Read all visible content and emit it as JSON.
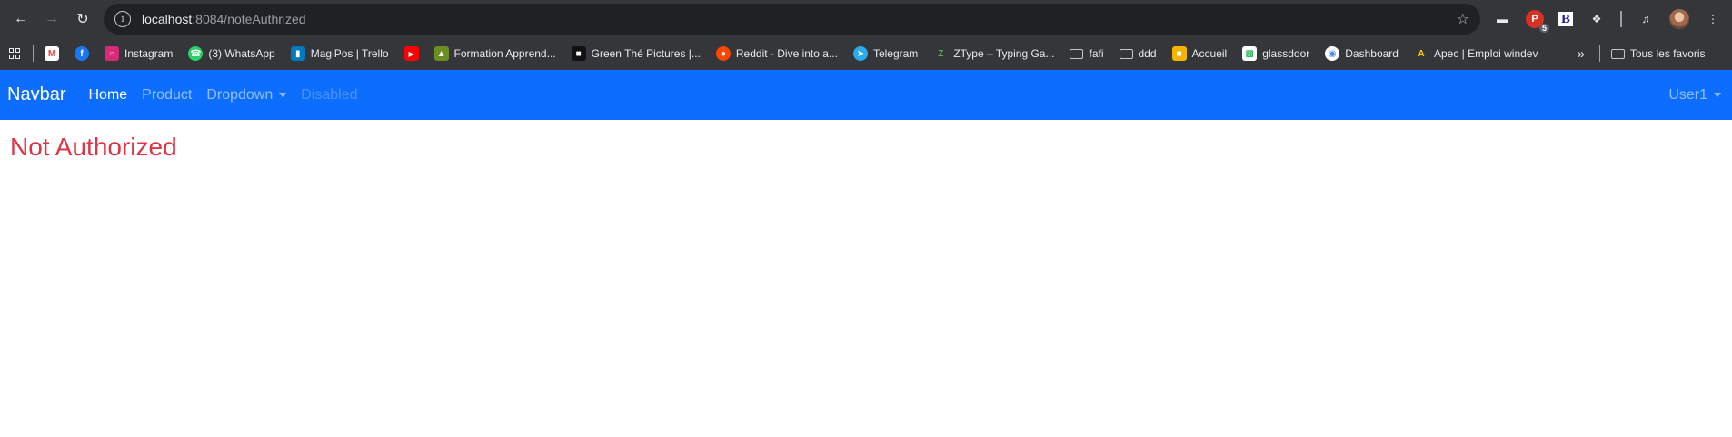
{
  "browser": {
    "url_host": "localhost",
    "url_rest": ":8084/noteAuthrized",
    "bookmarks": [
      {
        "label": "Instagram",
        "icon": "instagram-icon",
        "color": "#d62976"
      },
      {
        "label": "(3) WhatsApp",
        "icon": "whatsapp-icon",
        "color": "#25d366"
      },
      {
        "label": "MagiPos | Trello",
        "icon": "trello-icon",
        "color": "#0079bf"
      },
      {
        "label": "Formation Apprend...",
        "icon": "formation-icon",
        "color": "#6b8e23"
      },
      {
        "label": "Green Thé Pictures |...",
        "icon": "green-the-icon",
        "color": "#111111"
      },
      {
        "label": "Reddit - Dive into a...",
        "icon": "reddit-icon",
        "color": "#ff4500"
      },
      {
        "label": "Telegram",
        "icon": "telegram-icon",
        "color": "#2aabee"
      },
      {
        "label": "ZType – Typing Ga...",
        "icon": "ztype-icon",
        "color": "#35363a"
      },
      {
        "label": "fafi",
        "icon": "folder-icon",
        "color": ""
      },
      {
        "label": "ddd",
        "icon": "folder-icon",
        "color": ""
      },
      {
        "label": "Accueil",
        "icon": "accueil-icon",
        "color": "#f4b400"
      },
      {
        "label": "glassdoor",
        "icon": "glassdoor-icon",
        "color": "#0caa41"
      },
      {
        "label": "Dashboard",
        "icon": "dashboard-icon",
        "color": "#4285f4"
      },
      {
        "label": "Apec | Emploi windev",
        "icon": "apec-icon",
        "color": "#ffd200"
      }
    ],
    "all_bookmarks_label": "Tous les favoris",
    "ext_badge": "5"
  },
  "navbar": {
    "brand": "Navbar",
    "links": {
      "home": "Home",
      "product": "Product",
      "dropdown": "Dropdown",
      "disabled": "Disabled"
    },
    "user": "User1",
    "bg_color": "#0d6efd"
  },
  "main": {
    "title": "Not Authorized",
    "title_color": "#dc3545"
  }
}
